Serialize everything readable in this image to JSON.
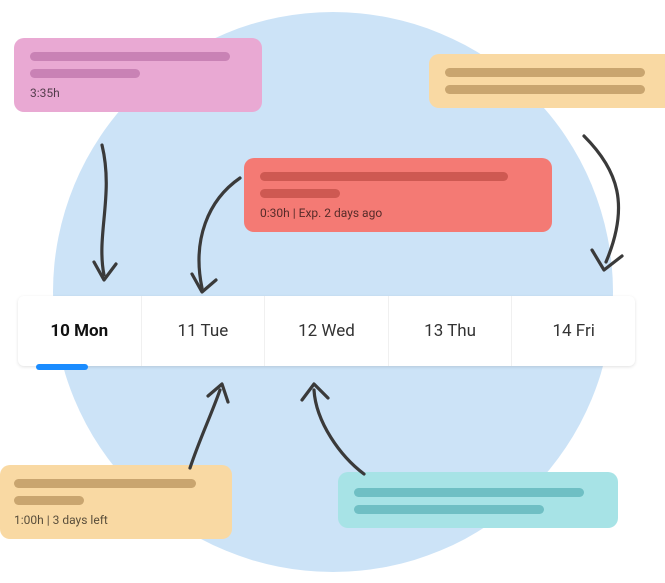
{
  "cards": {
    "pink": {
      "meta": "3:35h"
    },
    "red": {
      "meta": "0:30h | Exp. 2 days ago"
    },
    "orange_bottom": {
      "meta": "1:00h | 3 days left"
    }
  },
  "days": [
    {
      "label": "10 Mon",
      "selected": true
    },
    {
      "label": "11 Tue",
      "selected": false
    },
    {
      "label": "12 Wed",
      "selected": false
    },
    {
      "label": "13 Thu",
      "selected": false
    },
    {
      "label": "14 Fri",
      "selected": false
    }
  ]
}
